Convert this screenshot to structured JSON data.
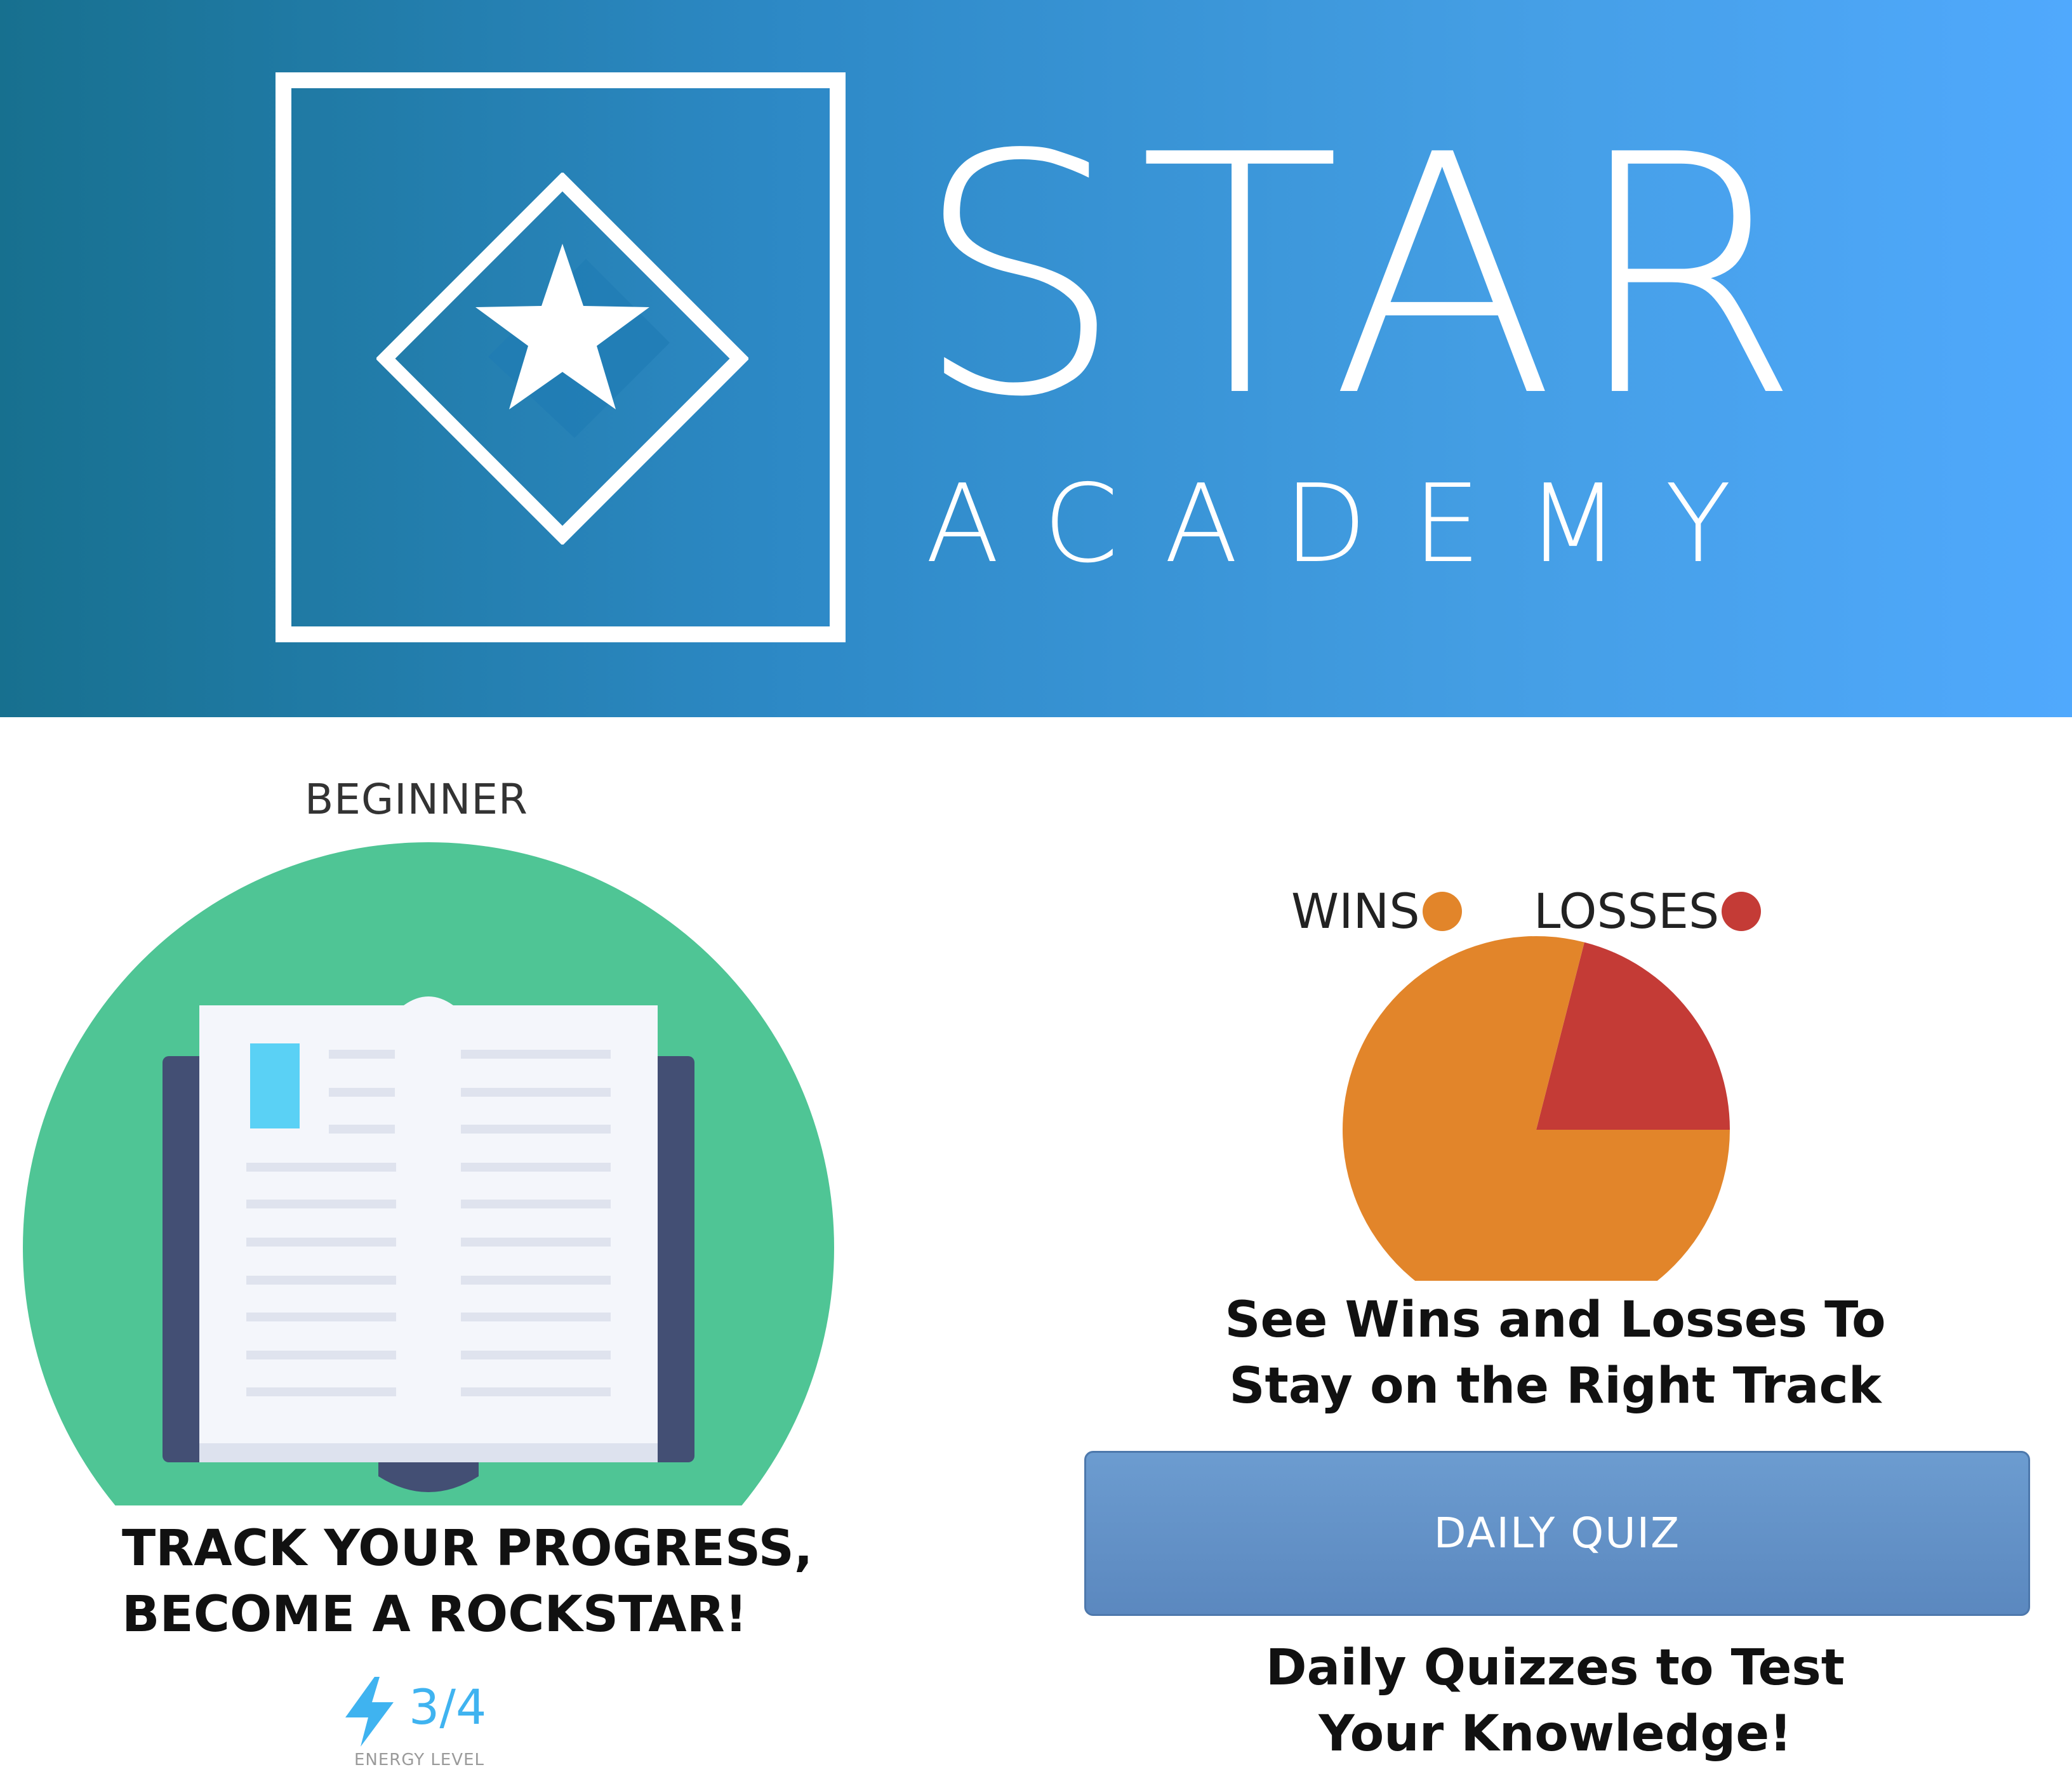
{
  "banner": {
    "brand_title": "STAR",
    "brand_subtitle": "ACADEMY",
    "gradient_colors": [
      "#17708f",
      "#50a9fd"
    ],
    "logo_icon": "star-diamond-icon"
  },
  "progress_panel": {
    "level": "BEGINNER",
    "illustration_icon": "open-book-icon",
    "caption_lines": [
      "TRACK YOUR PROGRESS,",
      "BECOME A ROCKSTAR!"
    ],
    "energy": {
      "icon": "lightning-bolt-icon",
      "value": "3/4",
      "label": "ENERGY LEVEL",
      "color": "#3fb3f0"
    }
  },
  "stats_panel": {
    "legend": [
      {
        "label": "WINS",
        "color": "#e2852a"
      },
      {
        "label": "LOSSES",
        "color": "#c43b36"
      }
    ],
    "caption_lines": [
      "See Wins and Losses To",
      "Stay on the Right Track"
    ]
  },
  "chart_data": {
    "type": "pie",
    "title": "",
    "categories": [
      "WINS",
      "LOSSES"
    ],
    "values": [
      79,
      21
    ],
    "colors": [
      "#e2852a",
      "#c43b36"
    ],
    "legend_position": "top"
  },
  "quiz_panel": {
    "button_label": "DAILY QUIZ",
    "button_color": "#6391c7",
    "caption_lines": [
      "Daily Quizzes to Test",
      "Your Knowledge!"
    ]
  }
}
